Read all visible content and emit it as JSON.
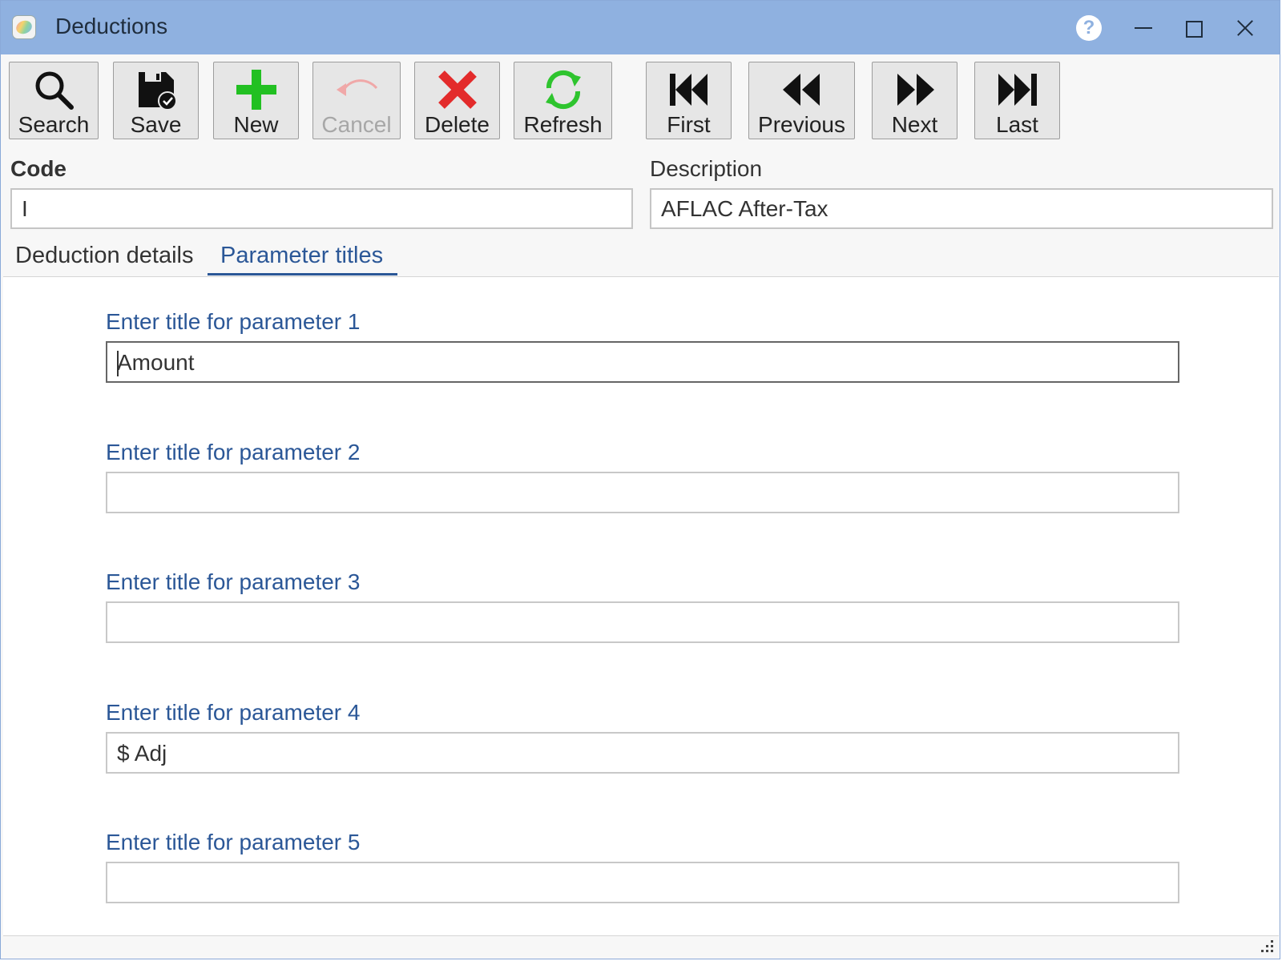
{
  "window": {
    "title": "Deductions"
  },
  "toolbar": {
    "search": "Search",
    "save": "Save",
    "new": "New",
    "cancel": "Cancel",
    "delete": "Delete",
    "refresh": "Refresh",
    "first": "First",
    "previous": "Previous",
    "next": "Next",
    "last": "Last"
  },
  "header": {
    "code_label": "Code",
    "code_value": "I",
    "description_label": "Description",
    "description_value": "AFLAC After-Tax"
  },
  "tabs": [
    {
      "label": "Deduction details",
      "active": false
    },
    {
      "label": "Parameter titles",
      "active": true
    }
  ],
  "params": [
    {
      "label": "Enter title for parameter 1",
      "value": "Amount"
    },
    {
      "label": "Enter title for parameter 2",
      "value": ""
    },
    {
      "label": "Enter title for parameter 3",
      "value": ""
    },
    {
      "label": "Enter title for parameter 4",
      "value": "$ Adj"
    },
    {
      "label": "Enter title for parameter 5",
      "value": ""
    }
  ],
  "colors": {
    "titlebar": "#8fb1e0",
    "accent": "#2b5797",
    "new_green": "#22c022",
    "delete_red": "#e32b2b",
    "refresh_green": "#2ec42e"
  }
}
